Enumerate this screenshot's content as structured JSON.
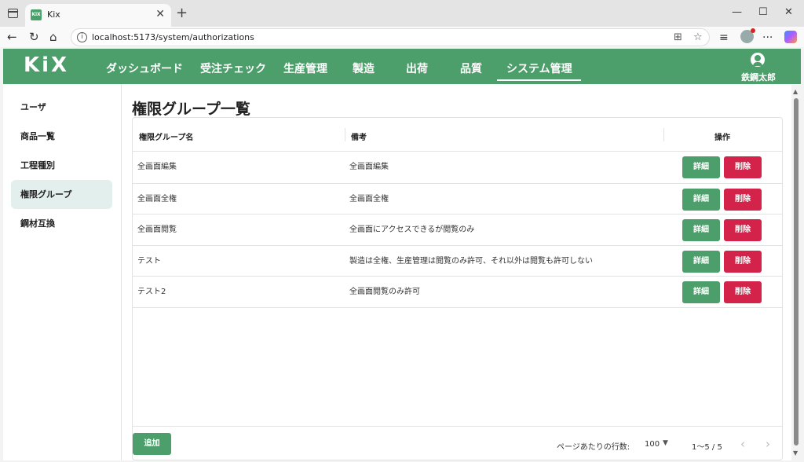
{
  "browser": {
    "tab_title": "Kix",
    "favicon_text": "KiX",
    "url": "localhost:5173/system/authorizations",
    "icons": [
      "window-icon",
      "close-icon",
      "new-tab-icon",
      "minimize-icon",
      "maximize-icon",
      "back-icon",
      "reload-icon",
      "home-icon",
      "info-icon",
      "split-screen-icon",
      "favorite-icon",
      "collections-icon",
      "profile-icon",
      "more-icon",
      "copilot-icon"
    ]
  },
  "header": {
    "logo": "KiX",
    "nav": [
      {
        "label": "ダッシュボード"
      },
      {
        "label": "受注チェック"
      },
      {
        "label": "生産管理"
      },
      {
        "label": "製造"
      },
      {
        "label": "出荷"
      },
      {
        "label": "品質"
      },
      {
        "label": "システム管理",
        "active": true
      }
    ],
    "user_name": "鉄鋼太郎",
    "brand_color": "#4c9e6b"
  },
  "sidebar": {
    "items": [
      {
        "label": "ユーザ"
      },
      {
        "label": "商品一覧"
      },
      {
        "label": "工程種別"
      },
      {
        "label": "権限グループ",
        "active": true
      },
      {
        "label": "鋼材互換"
      }
    ]
  },
  "main": {
    "title": "権限グループ一覧",
    "columns": [
      "権限グループ名",
      "備考",
      "操作"
    ],
    "rows": [
      {
        "name": "全画面編集",
        "note": "全画面編集"
      },
      {
        "name": "全画面全権",
        "note": "全画面全権"
      },
      {
        "name": "全画面閲覧",
        "note": "全画面にアクセスできるが閲覧のみ"
      },
      {
        "name": "テスト",
        "note": "製造は全権、生産管理は閲覧のみ許可、それ以外は閲覧も許可しない"
      },
      {
        "name": "テスト2",
        "note": "全画面閲覧のみ許可"
      }
    ],
    "detail_label": "詳細",
    "delete_label": "削除",
    "delete_color": "#d4234a",
    "add_label": "追加",
    "pagination": {
      "rows_per_page_label": "ページあたりの行数:",
      "rows_per_page": "100",
      "range": "1～5 / 5"
    }
  }
}
